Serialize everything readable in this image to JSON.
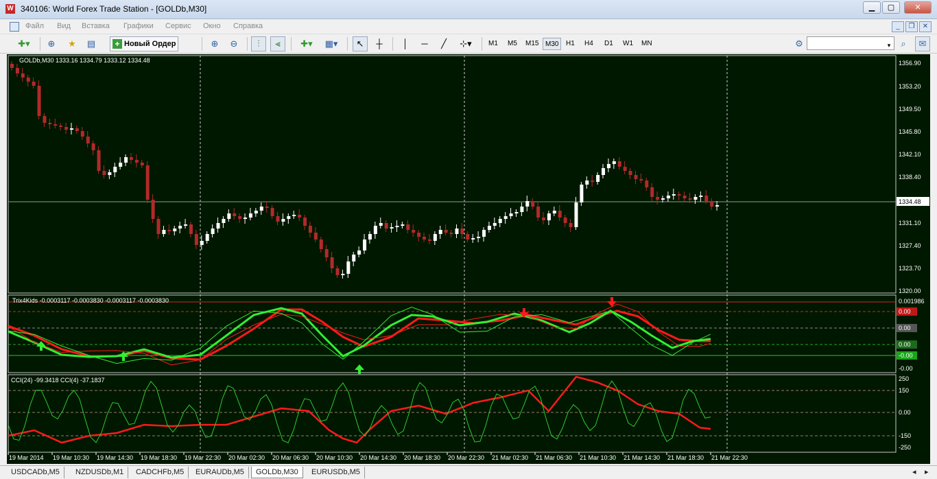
{
  "window": {
    "title": "340106: World Forex Trade Station - [GOLDb,M30]",
    "icon_letter": "W",
    "controls": [
      "minimize-icon",
      "maximize-icon",
      "close-icon"
    ]
  },
  "menu": [
    "Файл",
    "Вид",
    "Вставка",
    "Графики",
    "Сервис",
    "Окно",
    "Справка"
  ],
  "toolbar": {
    "new_order_label": "Новый Ордер",
    "timeframes": [
      "M1",
      "M5",
      "M15",
      "M30",
      "H1",
      "H4",
      "D1",
      "W1",
      "MN"
    ],
    "active_timeframe": "M30",
    "search_placeholder": ""
  },
  "chart": {
    "main_label": "GOLDb,M30  1333.16 1334.79 1333.12 1334.48",
    "price_axis": [
      "1356.90",
      "1353.20",
      "1349.50",
      "1345.80",
      "1342.10",
      "1338.40",
      "1334.48",
      "1331.10",
      "1327.40",
      "1323.70",
      "1320.00"
    ],
    "current_price": "1334.48",
    "trix_label": "Trix4Kids -0.0003117 -0.0003830 -0.0003117 -0.0003830",
    "trix_axis": [
      "0.001986",
      "0.00",
      "0.00",
      "0.00",
      "-0.00",
      "-0.00",
      "-0.001296"
    ],
    "cci_label": "CCI(24) -99.3418  CCI(4) -37.1837",
    "cci_axis": [
      "250",
      "150",
      "0.00",
      "0.00",
      "-150",
      "-250"
    ],
    "time_axis": [
      "19 Mar 2014",
      "19 Mar 10:30",
      "19 Mar 14:30",
      "19 Mar 18:30",
      "19 Mar 22:30",
      "20 Mar 02:30",
      "20 Mar 06:30",
      "20 Mar 10:30",
      "20 Mar 14:30",
      "20 Mar 18:30",
      "20 Mar 22:30",
      "21 Mar 02:30",
      "21 Mar 06:30",
      "21 Mar 10:30",
      "21 Mar 14:30",
      "21 Mar 18:30",
      "21 Mar 22:30"
    ],
    "colors": {
      "background": "#001800",
      "bull": "#ffffff",
      "bear": "#b22a2a",
      "trix_fast": "#33ee33",
      "trix_slow": "#ff1a1a",
      "cci_slow": "#ff1a1a",
      "cci_fast": "#2ecc2e"
    }
  },
  "tabs": [
    "USDCADb,M5",
    "NZDUSDb,M1",
    "CADCHFb,M5",
    "EURAUDb,M5",
    "GOLDb,M30",
    "EURUSDb,M5"
  ],
  "active_tab": "GOLDb,M30"
}
